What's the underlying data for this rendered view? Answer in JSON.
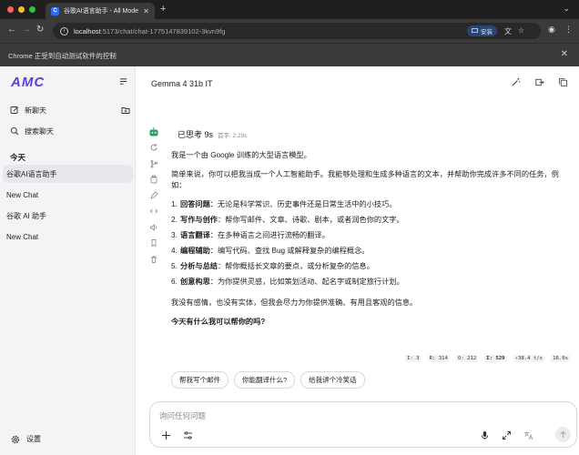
{
  "browser": {
    "tab_title": "谷歌AI语言助手 - All Model Ch",
    "tab_favicon_letter": "C",
    "new_tab": "+",
    "url_host": "localhost",
    "url_path": ":5173/chat/chat-1775147839102-3kvn9fg",
    "install_label": "安装",
    "automation_notice": "Chrome 正受到自动测试软件的控制"
  },
  "sidebar": {
    "logo": "AMC",
    "new_chat": "新聊天",
    "search_chat": "搜索聊天",
    "section_today": "今天",
    "conversations": [
      {
        "title": "谷歌AI语言助手",
        "active": true
      },
      {
        "title": "New Chat",
        "active": false
      },
      {
        "title": "谷歌 AI 助手",
        "active": false
      },
      {
        "title": "New Chat",
        "active": false
      }
    ],
    "settings": "设置"
  },
  "header": {
    "model_name": "Gemma 4 31b IT"
  },
  "message": {
    "thinking_label": "已思考 9s",
    "thinking_time": "首字: 2.29s",
    "intro": "我是一个由 Google 训练的大型语言模型。",
    "para": "简单来说，你可以把我当成一个人工智能助手。我能够处理和生成多种语言的文本，并帮助你完成许多不同的任务，例如：",
    "items": [
      {
        "num": "1.",
        "head": "回答问题",
        "body": "：无论是科学常识、历史事件还是日常生活中的小技巧。"
      },
      {
        "num": "2.",
        "head": "写作与创作",
        "body": "：帮你写邮件、文章、诗歌、剧本，或者润色你的文字。"
      },
      {
        "num": "3.",
        "head": "语言翻译",
        "body": "：在多种语言之间进行流畅的翻译。"
      },
      {
        "num": "4.",
        "head": "编程辅助",
        "body": "：编写代码、查找 Bug 或解释复杂的编程概念。"
      },
      {
        "num": "5.",
        "head": "分析与总结",
        "body": "：帮你概括长文章的要点，或分析复杂的信息。"
      },
      {
        "num": "6.",
        "head": "创意构思",
        "body": "：为你提供灵感，比如策划活动、起名字或制定旅行计划。"
      }
    ],
    "note": "我没有感情，也没有实体，但我会尽力为你提供准确、有用且客观的信息。",
    "closing": "今天有什么我可以帮你的吗?",
    "stats": {
      "i": "I: 3",
      "r": "R: 314",
      "o": "O: 212",
      "sigma": "Σ: 529",
      "speed": "⚡38.4 t/s",
      "time": "16.0s"
    }
  },
  "suggestions": [
    "帮我写个邮件",
    "你能翻译什么?",
    "给我讲个冷笑话"
  ],
  "input": {
    "placeholder": "询问任何问题"
  },
  "colors": {
    "brand": "#5b3fd6",
    "chrome_dark": "#3a3a3a",
    "sidebar_bg": "#f3f4f6",
    "active_item": "#e6e8eb"
  }
}
